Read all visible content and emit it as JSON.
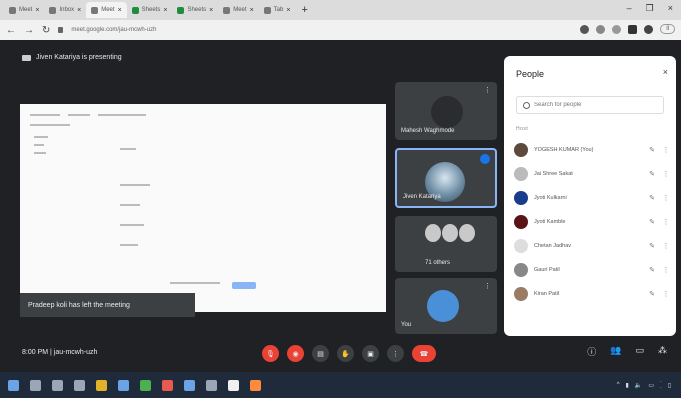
{
  "browser": {
    "tabs": [
      {
        "label": "Meet"
      },
      {
        "label": "Inbox"
      },
      {
        "label": "Meet"
      },
      {
        "label": "Sheets"
      },
      {
        "label": "Sheets"
      },
      {
        "label": "Meet"
      },
      {
        "label": "Tab"
      }
    ],
    "url": "meet.google.com/jau-mcwh-uzh"
  },
  "meet": {
    "presenting_text": "Jiven Katariya is presenting",
    "toast_text": "Pradeep koli has left the meeting",
    "tiles": [
      {
        "name": "Mahesh Waghmode"
      },
      {
        "name": "Jiven Katariya"
      },
      {
        "name": "71 others"
      },
      {
        "name": "You"
      }
    ],
    "time": "8:00 PM",
    "meeting_code": "jau-mcwh-uzh"
  },
  "people": {
    "title": "People",
    "search_placeholder": "Search for people",
    "section_label": "Host",
    "participants": [
      {
        "name": "YOGESH KUMAR (You)"
      },
      {
        "name": "Jai Shree Sakat"
      },
      {
        "name": "Jyoti Kulkarni"
      },
      {
        "name": "Jyoti Kamble"
      },
      {
        "name": "Chetan Jadhav"
      },
      {
        "name": "Gauri Patil"
      },
      {
        "name": "Kiran Patil"
      }
    ]
  },
  "colors": {
    "meet_bg": "#202124",
    "accent": "#8ab4f8",
    "hangup": "#ea4335"
  }
}
